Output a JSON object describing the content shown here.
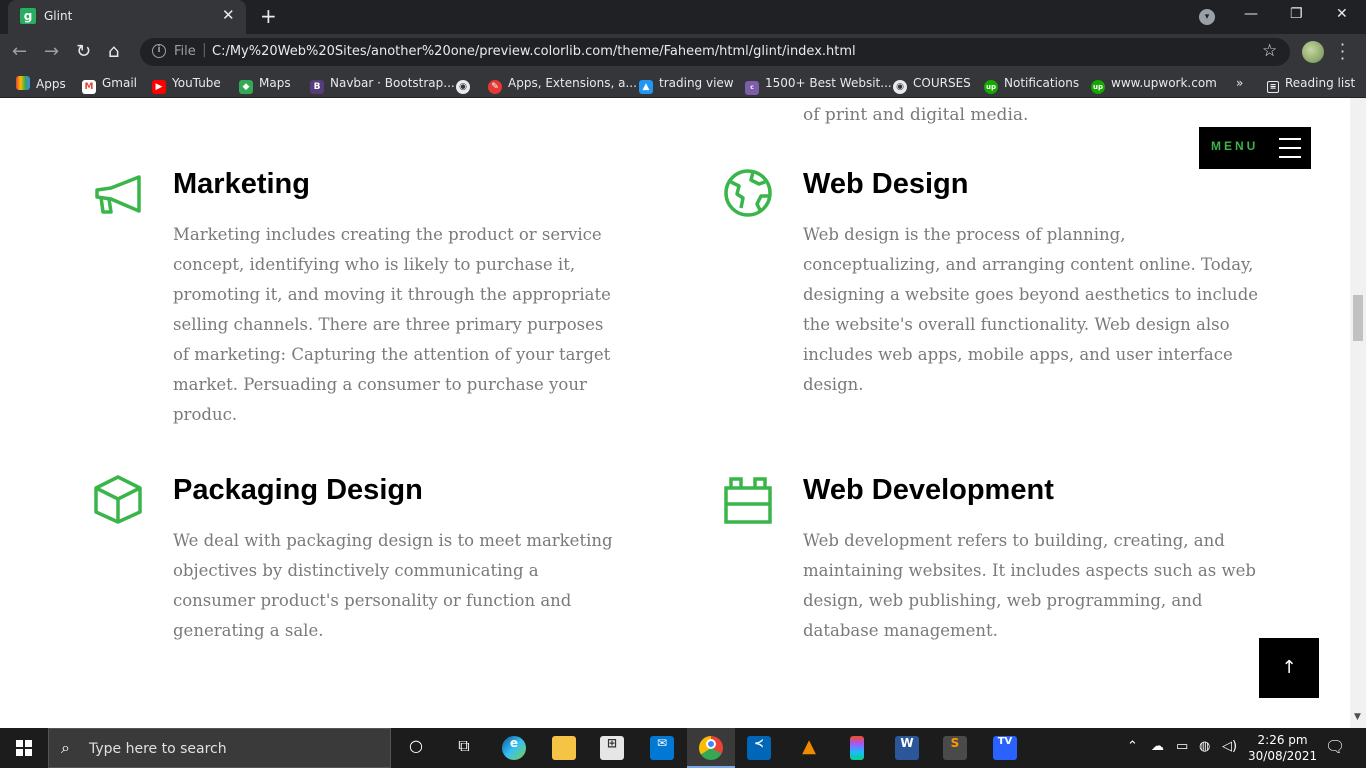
{
  "browser": {
    "tab_title": "Glint",
    "tab_favicon": "g",
    "file_label": "File",
    "url": "C:/My%20Web%20Sites/another%20one/preview.colorlib.com/theme/Faheem/html/glint/index.html",
    "bookmarks": [
      {
        "label": "Apps",
        "icon": "apps-grid-icon"
      },
      {
        "label": "Gmail",
        "icon": "gmail-icon"
      },
      {
        "label": "YouTube",
        "icon": "youtube-icon"
      },
      {
        "label": "Maps",
        "icon": "maps-icon"
      },
      {
        "label": "Navbar · Bootstrap...",
        "icon": "bootstrap-icon"
      },
      {
        "label": "",
        "icon": "globe-icon"
      },
      {
        "label": "Apps, Extensions, a...",
        "icon": "extensions-icon"
      },
      {
        "label": "trading view",
        "icon": "tradingview-icon"
      },
      {
        "label": "1500+ Best Websit...",
        "icon": "colorlib-icon"
      },
      {
        "label": "COURSES",
        "icon": "globe-icon"
      },
      {
        "label": "Notifications",
        "icon": "upwork-icon"
      },
      {
        "label": "www.upwork.com",
        "icon": "upwork-icon"
      }
    ],
    "more_bookmarks": "»",
    "reading_list": "Reading list"
  },
  "page": {
    "partial_text": "of print and digital media.",
    "menu_label": "MENU",
    "services": [
      {
        "title": "Marketing",
        "icon": "megaphone-icon",
        "description": "Marketing includes creating the product or service concept, identifying who is likely to purchase it, promoting it, and moving it through the appropriate selling channels. There are three primary purposes of marketing: Capturing the attention of your target market. Persuading a consumer to purchase your produc."
      },
      {
        "title": "Web Design",
        "icon": "globe-icon",
        "description": "Web design is the process of planning, conceptualizing, and arranging content online. Today, designing a website goes beyond aesthetics to include the website's overall functionality. Web design also includes web apps, mobile apps, and user interface design."
      },
      {
        "title": "Packaging Design",
        "icon": "box-icon",
        "description": "We deal with packaging design is to meet marketing objectives by distinctively communicating a consumer product's personality or function and generating a sale."
      },
      {
        "title": "Web Development",
        "icon": "lego-brick-icon",
        "description": "Web development refers to building, creating, and maintaining websites. It includes aspects such as web design, web publishing, web programming, and database management."
      }
    ],
    "accent_color": "#39b54a",
    "back_to_top": "↑"
  },
  "taskbar": {
    "search_placeholder": "Type here to search",
    "time": "2:26 pm",
    "date": "30/08/2021"
  }
}
